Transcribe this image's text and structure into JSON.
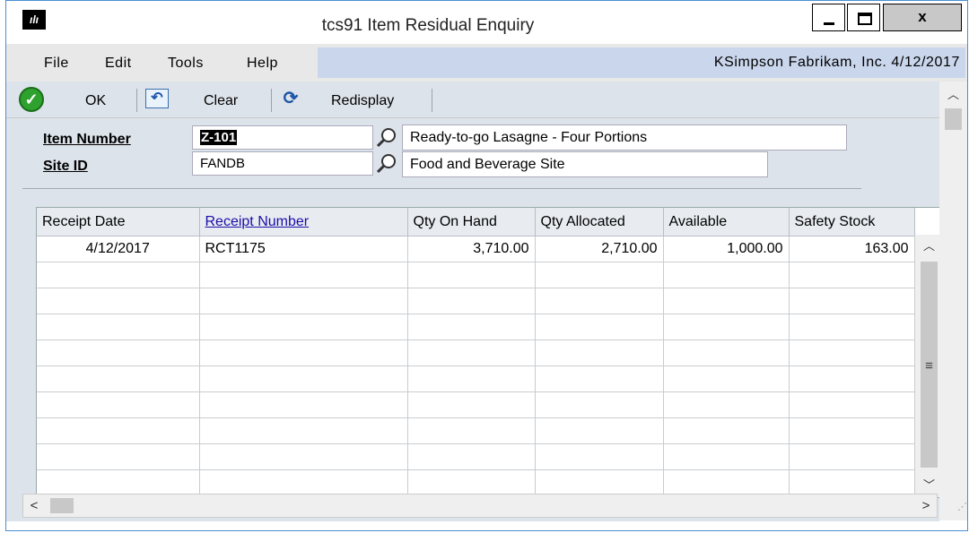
{
  "window": {
    "title": "tcs91 Item Residual Enquiry",
    "close_glyph": "x"
  },
  "menu": {
    "items": [
      "File",
      "Edit",
      "Tools",
      "Help"
    ],
    "info": "KSimpson  Fabrikam, Inc.  4/12/2017"
  },
  "toolbar": {
    "ok_label": "OK",
    "clear_label": "Clear",
    "redisplay_label": "Redisplay"
  },
  "form": {
    "item_number_label": "Item Number",
    "item_number_value": "Z-101",
    "item_description": "Ready-to-go Lasagne - Four Portions",
    "site_id_label": "Site ID",
    "site_id_value": "FANDB",
    "site_description": "Food and Beverage Site"
  },
  "grid": {
    "columns": [
      "Receipt Date",
      "Receipt Number",
      "Qty On Hand",
      "Qty Allocated",
      "Available",
      "Safety Stock"
    ],
    "rows": [
      [
        "4/12/2017",
        "RCT1175",
        "3,710.00",
        "2,710.00",
        "1,000.00",
        "163.00"
      ]
    ]
  },
  "colors": {
    "accent": "#4a8fd0",
    "link": "#1a0dab",
    "ok_green": "#2ea12e",
    "panel": "#dde3ea",
    "info_bar": "#c9d6ec"
  },
  "icons": [
    "app-logo-icon",
    "minimize-icon",
    "maximize-icon",
    "close-icon",
    "ok-check-icon",
    "clear-undo-icon",
    "redisplay-refresh-icon",
    "lookup-magnifier-icon"
  ]
}
